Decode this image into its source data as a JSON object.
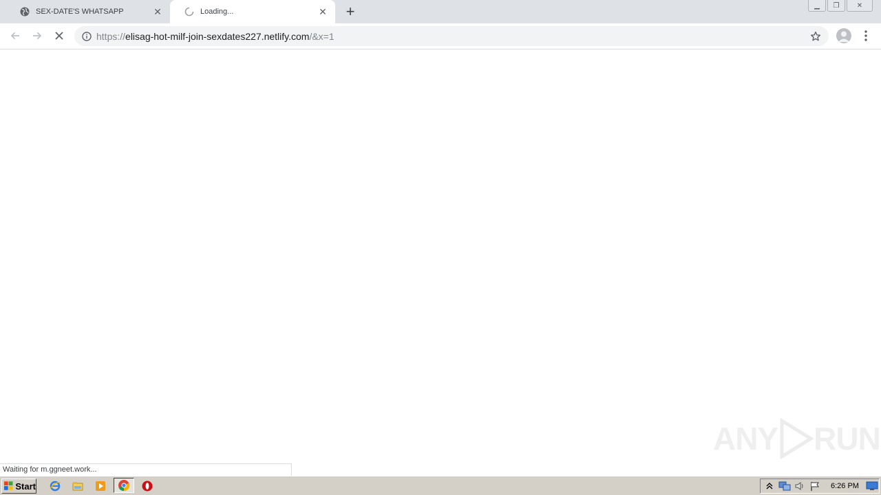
{
  "browser": {
    "tabs": [
      {
        "title": "SEX-DATE'S WHATSAPP",
        "icon": "globe-icon",
        "active": false
      },
      {
        "title": "Loading...",
        "icon": "loading-spinner-icon",
        "active": true
      }
    ],
    "newtab_label": "+",
    "url": {
      "scheme": "https://",
      "host": "elisag-hot-milf-join-sexdates227.netlify.com",
      "rest": "/&x=1"
    },
    "status_text": "Waiting for m.ggneet.work..."
  },
  "watermark": {
    "text_left": "ANY",
    "text_right": "RUN"
  },
  "taskbar": {
    "start_label": "Start",
    "clock": "6:26 PM",
    "quick_launch": [
      "internet-explorer-icon",
      "file-explorer-icon",
      "media-player-icon",
      "chrome-icon",
      "opera-icon"
    ],
    "tray": [
      "show-hidden-icons-icon",
      "network-icon",
      "volume-icon",
      "action-center-flag-icon",
      "show-desktop-icon"
    ]
  },
  "colors": {
    "tabstrip": "#dee1e6",
    "omnibox": "#f1f3f4",
    "taskbar": "#d4d0c8"
  }
}
